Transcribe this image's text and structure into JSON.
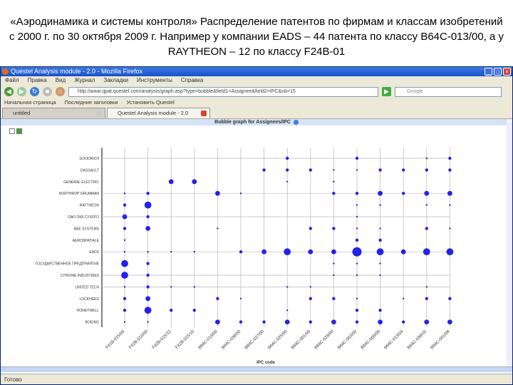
{
  "slide_title": "«Аэродинамика и системы контроля» Распределение патентов по фирмам и классам изобретений с 2000 г. по 30 октября 2009 г. Например у компании EADS – 44 патента по классу B64C-013/00, а у RAYTHEON – 12 по классу F24B-01",
  "window": {
    "title": "Questel Analysis module - 2.0 - Mozilla Firefox"
  },
  "menu": [
    "Файл",
    "Правка",
    "Вид",
    "Журнал",
    "Закладки",
    "Инструменты",
    "Справка"
  ],
  "nav": {
    "url": "http://www.qpat.questel.com/analysis/graph.asp?type=bubble&field1=Assignee&field2=IPC&nb=15",
    "search_placeholder": "Google"
  },
  "bookmarks": [
    "Начальная страница",
    "Последние заголовки",
    "Установить Questel"
  ],
  "tabs": [
    {
      "label": "untitled"
    },
    {
      "label": "Questel Analysis module - 2.0"
    }
  ],
  "graph_header": "Bubble graph for Assignees/IPC",
  "status": "Готово",
  "colors": {
    "bubble": "#2323e8",
    "grid": "#b8b8c0"
  },
  "chart_data": {
    "type": "scatter",
    "subtype": "bubble",
    "xlabel": "IPC code",
    "x_categories": [
      "F41B-015/00",
      "F42B-010/00",
      "F42B-015/22",
      "F42B-015/10",
      "B64C-013/00",
      "B64C-039/00",
      "B64C-027/00",
      "B64C-025/00",
      "B64C-001/00",
      "B64C-029/00",
      "B64C-003/00",
      "B64C-009/00",
      "B64C-013/04",
      "B64C-039/02",
      "B64C-001/06"
    ],
    "y_categories": [
      "GOODRICH",
      "DASSAULT",
      "GENERAL ELECTRIC",
      "NORTHROP GRUMMAN",
      "RAYTHEON",
      "ОАО ОКБ СУХОГО",
      "BAE SYSTEMS",
      "AEROSPATIALE",
      "EADS",
      "ГОСУДАРСТВЕННОЕ ПРЕДПРИЯТИЕ",
      "CITRONE INDUSTRIES",
      "UNITED TECH",
      "LOCKHEED",
      "HONEYWELL",
      "BOEING"
    ],
    "values": [
      [
        0,
        0,
        0,
        0,
        0,
        0,
        0,
        5,
        0,
        0,
        5,
        0,
        0,
        1,
        5
      ],
      [
        0,
        0,
        0,
        0,
        0,
        0,
        5,
        5,
        5,
        1,
        1,
        5,
        5,
        5,
        5
      ],
      [
        0,
        0,
        12,
        12,
        0,
        0,
        0,
        1,
        0,
        1,
        0,
        0,
        0,
        0,
        0
      ],
      [
        1,
        5,
        0,
        0,
        12,
        1,
        0,
        0,
        0,
        5,
        5,
        12,
        5,
        12,
        12
      ],
      [
        5,
        25,
        0,
        0,
        0,
        0,
        0,
        0,
        0,
        0,
        1,
        1,
        0,
        1,
        1
      ],
      [
        12,
        5,
        0,
        0,
        0,
        0,
        0,
        0,
        0,
        0,
        1,
        0,
        0,
        0,
        0
      ],
      [
        5,
        12,
        0,
        0,
        1,
        0,
        0,
        0,
        5,
        5,
        1,
        1,
        0,
        5,
        1
      ],
      [
        1,
        0,
        0,
        0,
        0,
        0,
        0,
        0,
        0,
        0,
        5,
        5,
        0,
        0,
        0
      ],
      [
        1,
        1,
        1,
        1,
        0,
        5,
        12,
        25,
        12,
        12,
        44,
        25,
        12,
        25,
        25
      ],
      [
        25,
        5,
        0,
        0,
        0,
        0,
        0,
        0,
        0,
        1,
        1,
        1,
        0,
        0,
        0
      ],
      [
        25,
        5,
        0,
        0,
        0,
        0,
        0,
        0,
        0,
        1,
        1,
        1,
        0,
        0,
        0
      ],
      [
        1,
        5,
        1,
        1,
        0,
        0,
        0,
        1,
        1,
        0,
        0,
        0,
        0,
        1,
        0
      ],
      [
        5,
        12,
        0,
        0,
        5,
        1,
        0,
        0,
        5,
        5,
        1,
        0,
        1,
        5,
        5
      ],
      [
        5,
        25,
        5,
        5,
        0,
        0,
        0,
        1,
        0,
        0,
        5,
        5,
        0,
        0,
        0
      ],
      [
        1,
        1,
        0,
        0,
        12,
        5,
        5,
        12,
        5,
        12,
        5,
        12,
        5,
        12,
        12
      ]
    ]
  }
}
